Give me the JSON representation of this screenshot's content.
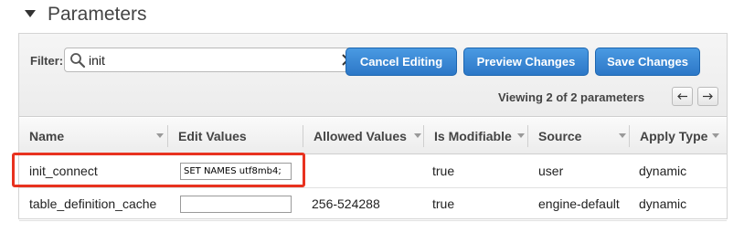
{
  "section": {
    "title": "Parameters"
  },
  "toolbar": {
    "filter_label": "Filter:",
    "search_value": "init",
    "cancel_label": "Cancel Editing",
    "preview_label": "Preview Changes",
    "save_label": "Save Changes",
    "viewing_text": "Viewing 2 of 2 parameters"
  },
  "columns": {
    "name": "Name",
    "edit_values": "Edit Values",
    "allowed_values": "Allowed Values",
    "is_modifiable": "Is Modifiable",
    "source": "Source",
    "apply_type": "Apply Type"
  },
  "rows": [
    {
      "name": "init_connect",
      "edit_value": "SET NAMES utf8mb4;",
      "allowed_values": "",
      "is_modifiable": "true",
      "source": "user",
      "apply_type": "dynamic"
    },
    {
      "name": "table_definition_cache",
      "edit_value": "",
      "allowed_values": "256-524288",
      "is_modifiable": "true",
      "source": "engine-default",
      "apply_type": "dynamic"
    }
  ],
  "colors": {
    "button": "#2c77c7",
    "highlight": "#e8321f"
  },
  "icons": [
    "collapse-arrow-icon",
    "search-icon",
    "clear-icon",
    "pager-prev-icon",
    "pager-next-icon",
    "sort-arrow-icon"
  ]
}
